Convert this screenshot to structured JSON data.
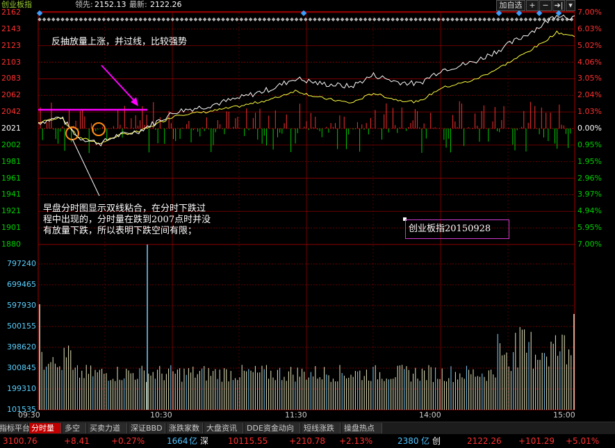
{
  "header": {
    "index_name": "创业板指",
    "lead_label": "领先:",
    "lead_value": "2152.13",
    "latest_label": "最新:",
    "latest_value": "2122.26",
    "add_fav": "加自选",
    "btn_plus": "+",
    "btn_minus": "−",
    "btn_arrow": "➔|",
    "btn_drop": "▾"
  },
  "price_axis": {
    "labels": [
      "2162",
      "2143",
      "2123",
      "2103",
      "2083",
      "2062",
      "2042",
      "2021",
      "2002",
      "1981",
      "1961",
      "1941",
      "1921",
      "1901",
      "1880"
    ],
    "base": "2021"
  },
  "pct_axis": {
    "labels": [
      "7.00%",
      "6.03%",
      "5.02%",
      "4.06%",
      "3.05%",
      "2.04%",
      "1.03%",
      "0.00%",
      "0.95%",
      "1.95%",
      "2.96%",
      "3.97%",
      "4.94%",
      "5.95%",
      "7.00%"
    ]
  },
  "volume_axis": {
    "labels": [
      "797240",
      "699465",
      "597930",
      "500155",
      "398620",
      "300845",
      "199310",
      "101535"
    ]
  },
  "time_axis": {
    "labels": [
      "09:30",
      "10:30",
      "11:30",
      "14:00",
      "15:00"
    ]
  },
  "annotations": {
    "top_note": "反抽放量上涨，并过线，比较强势",
    "bottom_note_1": "早盘分时图显示双线粘合，在分时下跌过",
    "bottom_note_2": "程中出现的，分时量在跌到2007点时并没",
    "bottom_note_3": "有放量下跌，所以表明下跌空间有限；",
    "stamp": "创业板指20150928"
  },
  "tabs": [
    "指标平台",
    "分时量",
    "多空",
    "买卖力道",
    "深证BBD",
    "涨跌家数",
    "大盘资讯",
    "DDE资金动向",
    "短线涨跌",
    "操盘热点"
  ],
  "active_tab": "分时量",
  "status_bar": {
    "sh_index": "3100.76",
    "sh_change": "+8.41",
    "sh_pct": "+0.27%",
    "sh_amount": "1664",
    "sh_unit": "亿",
    "sz_name": "深",
    "sz_index": "10115.55",
    "sz_change": "+210.78",
    "sz_pct": "+2.13%",
    "cy_amount": "2380",
    "cy_unit": "亿",
    "cy_name": "创",
    "cy_index": "2122.26",
    "cy_change": "+101.29",
    "cy_pct": "+5.01%"
  },
  "colors": {
    "up": "#ff3030",
    "down": "#00d000",
    "grid": "#8b0000",
    "price_line": "#ffffff",
    "avg_line": "#ffff40",
    "volume": "#e8e8c0",
    "annotation_arrow": "#ff00ff",
    "highlight_circle": "#ff8c1a"
  }
}
